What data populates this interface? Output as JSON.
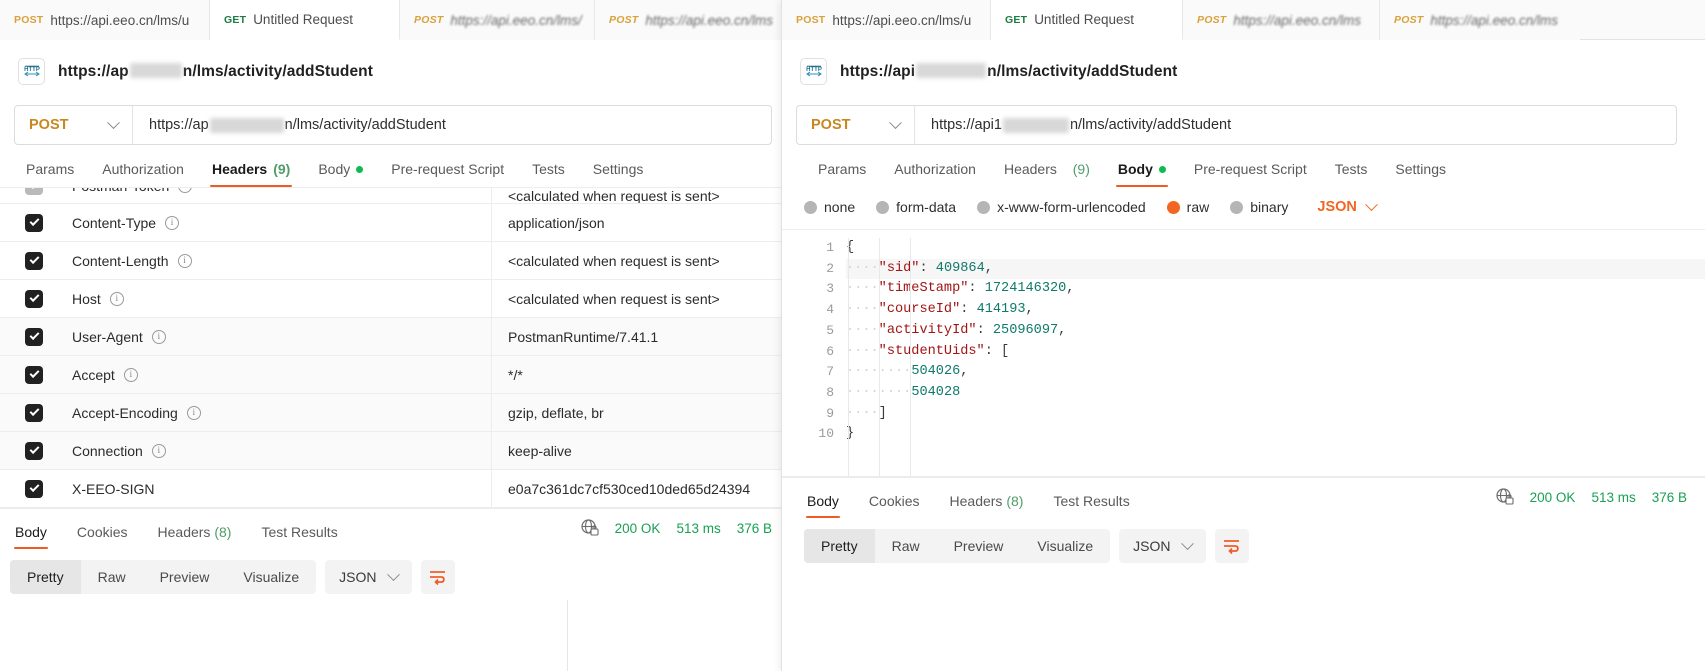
{
  "left_panel": {
    "tabs": [
      {
        "method": "POST",
        "title": "https://api.eeo.cn/lms/u",
        "active": false,
        "italic": false,
        "blurred": false
      },
      {
        "method": "GET",
        "title": "Untitled Request",
        "active": true,
        "italic": false,
        "blurred": false
      },
      {
        "method": "POST",
        "title": "https://api.eeo.cn/lms/",
        "active": false,
        "italic": true,
        "blurred": true
      },
      {
        "method": "POST",
        "title": "https://api.eeo.cn/lms",
        "active": false,
        "italic": true,
        "blurred": true
      }
    ],
    "breadcrumb": {
      "icon": "http-icon",
      "name": "https://api.eeo.cn/lms/activity/addStudent"
    },
    "request": {
      "method": "POST",
      "url_prefix": "https://ap",
      "url_suffix": "n/lms/activity/addStudent"
    },
    "request_tabs": [
      {
        "label": "Params",
        "selected": false,
        "count": "",
        "dot": false
      },
      {
        "label": "Authorization",
        "selected": false,
        "count": "",
        "dot": false
      },
      {
        "label": "Headers",
        "selected": true,
        "count": "(9)",
        "dot": false
      },
      {
        "label": "Body",
        "selected": false,
        "count": "",
        "dot": true
      },
      {
        "label": "Pre-request Script",
        "selected": false,
        "count": "",
        "dot": false
      },
      {
        "label": "Tests",
        "selected": false,
        "count": "",
        "dot": false
      },
      {
        "label": "Settings",
        "selected": false,
        "count": "",
        "dot": false
      }
    ],
    "headers_table": {
      "rows": [
        {
          "checked": true,
          "key": "Postman-Token",
          "info": true,
          "value": "<calculated when request is sent>",
          "clipped": true
        },
        {
          "checked": true,
          "key": "Content-Type",
          "info": true,
          "value": "application/json",
          "clipped": false
        },
        {
          "checked": true,
          "key": "Content-Length",
          "info": true,
          "value": "<calculated when request is sent>",
          "clipped": false
        },
        {
          "checked": true,
          "key": "Host",
          "info": true,
          "value": "<calculated when request is sent>",
          "clipped": false
        },
        {
          "checked": true,
          "key": "User-Agent",
          "info": true,
          "value": "PostmanRuntime/7.41.1",
          "clipped": false
        },
        {
          "checked": true,
          "key": "Accept",
          "info": true,
          "value": "*/*",
          "clipped": false
        },
        {
          "checked": true,
          "key": "Accept-Encoding",
          "info": true,
          "value": "gzip, deflate, br",
          "clipped": false
        },
        {
          "checked": true,
          "key": "Connection",
          "info": true,
          "value": "keep-alive",
          "clipped": false
        },
        {
          "checked": true,
          "key": "X-EEO-SIGN",
          "info": false,
          "value": "e0a7c361dc7cf530ced10ded65d24394",
          "clipped": false
        }
      ]
    },
    "response": {
      "tabs": [
        {
          "label": "Body",
          "selected": true,
          "count": ""
        },
        {
          "label": "Cookies",
          "selected": false,
          "count": ""
        },
        {
          "label": "Headers",
          "selected": false,
          "count": "(8)"
        },
        {
          "label": "Test Results",
          "selected": false,
          "count": ""
        }
      ],
      "status": "200 OK",
      "time": "513 ms",
      "size": "376 B",
      "globe_icon": "globe-lock-icon",
      "view_modes": [
        "Pretty",
        "Raw",
        "Preview",
        "Visualize"
      ],
      "view_mode_selected": "Pretty",
      "format": "JSON",
      "wrap_icon": "wrap-lines-icon"
    }
  },
  "right_panel": {
    "tabs": [
      {
        "method": "POST",
        "title": "https://api.eeo.cn/lms/u",
        "active": false,
        "italic": false,
        "blurred": false
      },
      {
        "method": "GET",
        "title": "Untitled Request",
        "active": true,
        "italic": false,
        "blurred": false
      },
      {
        "method": "POST",
        "title": "https://api.eeo.cn/lms",
        "active": false,
        "italic": true,
        "blurred": true
      },
      {
        "method": "POST",
        "title": "https://api.eeo.cn/lms",
        "active": false,
        "italic": true,
        "blurred": true
      }
    ],
    "breadcrumb": {
      "icon": "http-icon",
      "name": "https://api.eeo.cn/lms/activity/addStudent"
    },
    "request": {
      "method": "POST",
      "url_prefix": "https://api1",
      "url_suffix": "n/lms/activity/addStudent"
    },
    "request_tabs": [
      {
        "label": "Params",
        "selected": false,
        "count": "",
        "dot": false
      },
      {
        "label": "Authorization",
        "selected": false,
        "count": "",
        "dot": false
      },
      {
        "label": "Headers",
        "selected": false,
        "count": "(9)",
        "dot": false
      },
      {
        "label": "Body",
        "selected": true,
        "count": "",
        "dot": true
      },
      {
        "label": "Pre-request Script",
        "selected": false,
        "count": "",
        "dot": false
      },
      {
        "label": "Tests",
        "selected": false,
        "count": "",
        "dot": false
      },
      {
        "label": "Settings",
        "selected": false,
        "count": "",
        "dot": false
      }
    ],
    "body_types": [
      {
        "label": "none",
        "selected": false
      },
      {
        "label": "form-data",
        "selected": false
      },
      {
        "label": "x-www-form-urlencoded",
        "selected": false
      },
      {
        "label": "raw",
        "selected": true
      },
      {
        "label": "binary",
        "selected": false
      }
    ],
    "body_format": "JSON",
    "editor": {
      "lines": [
        {
          "n": "1",
          "indent": 0,
          "tokens": [
            {
              "t": "{",
              "c": "p"
            }
          ],
          "highlight": false
        },
        {
          "n": "2",
          "indent": 2,
          "tokens": [
            {
              "t": "\"sid\"",
              "c": "k"
            },
            {
              "t": ": ",
              "c": "p"
            },
            {
              "t": "409864",
              "c": "n"
            },
            {
              "t": ",",
              "c": "p"
            }
          ],
          "highlight": true
        },
        {
          "n": "3",
          "indent": 2,
          "tokens": [
            {
              "t": "\"timeStamp\"",
              "c": "k"
            },
            {
              "t": ": ",
              "c": "p"
            },
            {
              "t": "1724146320",
              "c": "n"
            },
            {
              "t": ",",
              "c": "p"
            }
          ],
          "highlight": false
        },
        {
          "n": "4",
          "indent": 2,
          "tokens": [
            {
              "t": "\"courseId\"",
              "c": "k"
            },
            {
              "t": ": ",
              "c": "p"
            },
            {
              "t": "414193",
              "c": "n"
            },
            {
              "t": ",",
              "c": "p"
            }
          ],
          "highlight": false
        },
        {
          "n": "5",
          "indent": 2,
          "tokens": [
            {
              "t": "\"activityId\"",
              "c": "k"
            },
            {
              "t": ": ",
              "c": "p"
            },
            {
              "t": "25096097",
              "c": "n"
            },
            {
              "t": ",",
              "c": "p"
            }
          ],
          "highlight": false
        },
        {
          "n": "6",
          "indent": 2,
          "tokens": [
            {
              "t": "\"studentUids\"",
              "c": "k"
            },
            {
              "t": ": ",
              "c": "p"
            },
            {
              "t": "[",
              "c": "p"
            }
          ],
          "highlight": false
        },
        {
          "n": "7",
          "indent": 4,
          "tokens": [
            {
              "t": "504026",
              "c": "n"
            },
            {
              "t": ",",
              "c": "p"
            }
          ],
          "highlight": false
        },
        {
          "n": "8",
          "indent": 4,
          "tokens": [
            {
              "t": "504028",
              "c": "n"
            }
          ],
          "highlight": false
        },
        {
          "n": "9",
          "indent": 2,
          "tokens": [
            {
              "t": "]",
              "c": "p"
            }
          ],
          "highlight": false
        },
        {
          "n": "10",
          "indent": 0,
          "tokens": [
            {
              "t": "}",
              "c": "p"
            }
          ],
          "highlight": false
        }
      ]
    },
    "response": {
      "tabs": [
        {
          "label": "Body",
          "selected": true,
          "count": ""
        },
        {
          "label": "Cookies",
          "selected": false,
          "count": ""
        },
        {
          "label": "Headers",
          "selected": false,
          "count": "(8)"
        },
        {
          "label": "Test Results",
          "selected": false,
          "count": ""
        }
      ],
      "status": "200 OK",
      "time": "513 ms",
      "size": "376 B",
      "globe_icon": "globe-lock-icon",
      "view_modes": [
        "Pretty",
        "Raw",
        "Preview",
        "Visualize"
      ],
      "view_mode_selected": "Pretty",
      "format": "JSON",
      "wrap_icon": "wrap-lines-icon"
    }
  },
  "colors": {
    "accent": "#ef5b25",
    "post": "#d9a13b",
    "get": "#1e7a42",
    "success": "#1aa053",
    "dot_green": "#0cbb52"
  }
}
